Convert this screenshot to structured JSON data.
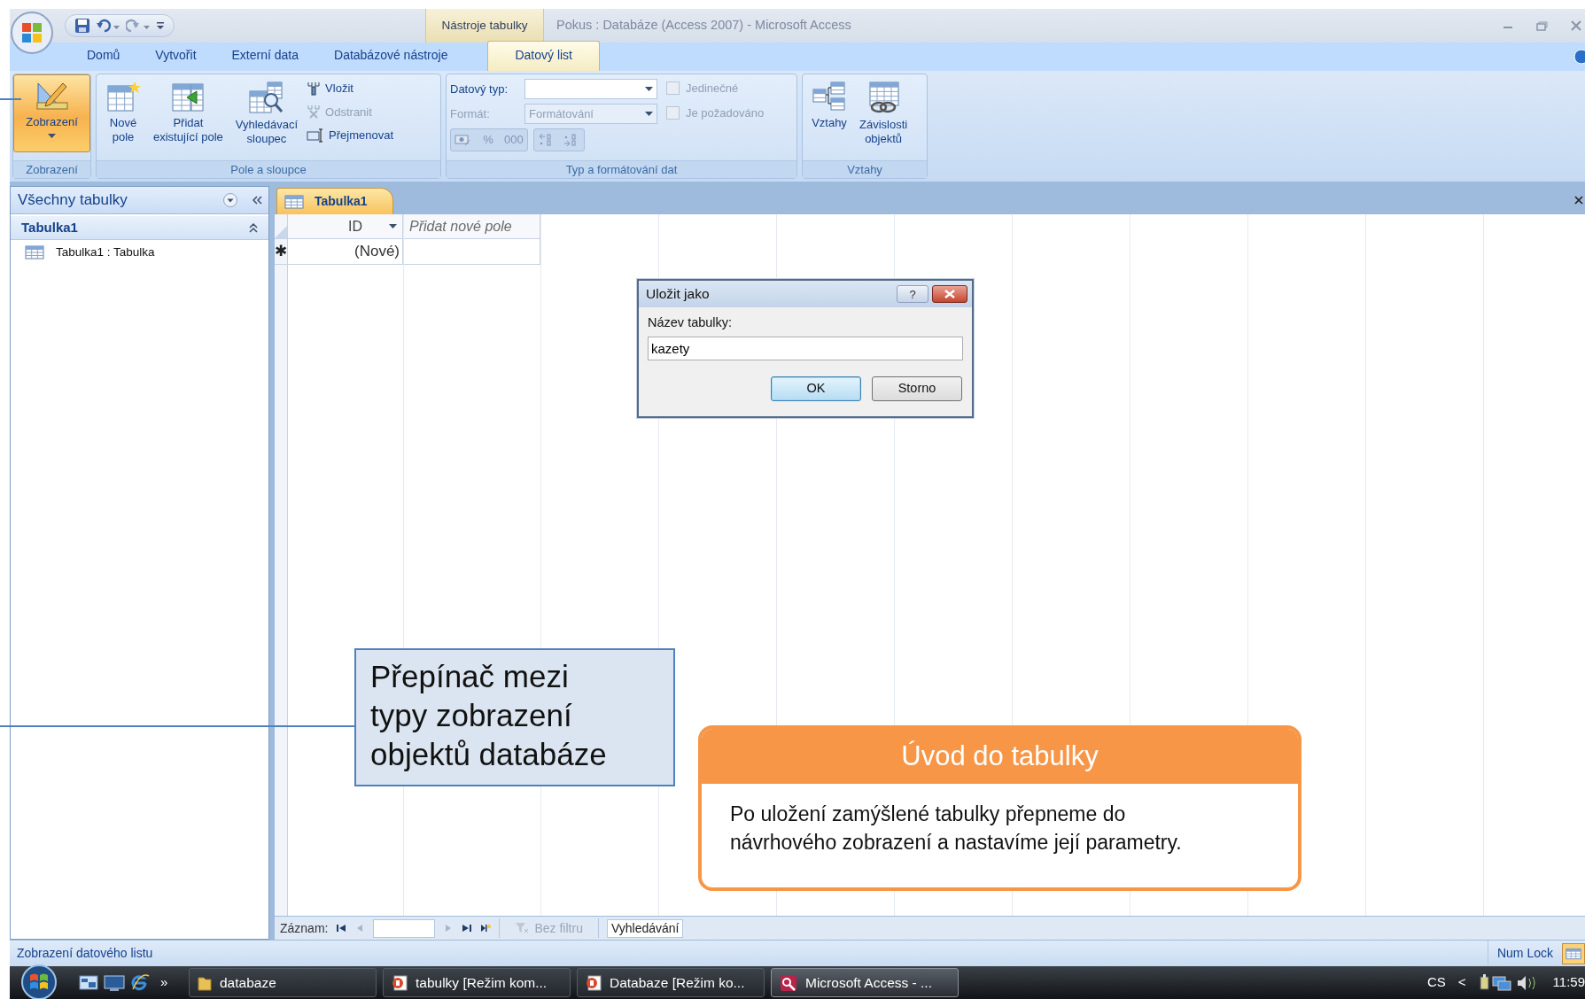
{
  "window": {
    "context_tab": "Nástroje tabulky",
    "title": "Pokus : Databáze (Access 2007) - Microsoft Access"
  },
  "ribbon_tabs": [
    {
      "label": "Domů",
      "selected": false
    },
    {
      "label": "Vytvořit",
      "selected": false
    },
    {
      "label": "Externí data",
      "selected": false
    },
    {
      "label": "Databázové nástroje",
      "selected": false
    },
    {
      "label": "Datový list",
      "selected": true
    }
  ],
  "ribbon_groups": [
    {
      "label": "Zobrazení",
      "items": [
        {
          "kind": "large",
          "lines": [
            "Zobrazení"
          ],
          "dropdown": true,
          "selected": true
        }
      ]
    },
    {
      "label": "Pole a sloupce",
      "items": [
        {
          "kind": "large",
          "lines": [
            "Nové",
            "pole"
          ],
          "dropdown": false,
          "selected": false
        },
        {
          "kind": "large",
          "lines": [
            "Přidat",
            "existující pole"
          ],
          "dropdown": false,
          "selected": false
        },
        {
          "kind": "large",
          "lines": [
            "Vyhledávací",
            "sloupec"
          ],
          "dropdown": false,
          "selected": false
        },
        {
          "kind": "stack",
          "items": [
            {
              "label": "Vložit",
              "disabled": false
            },
            {
              "label": "Odstranit",
              "disabled": true
            },
            {
              "label": "Přejmenovat",
              "disabled": false
            }
          ]
        }
      ]
    },
    {
      "label": "Typ a formátování dat",
      "items": [
        {
          "kind": "form",
          "rows": [
            {
              "label": "Datový typ:",
              "disabled": false
            },
            {
              "label": "Formát:",
              "value": "Formátování",
              "disabled": true
            }
          ],
          "buttons": [
            {
              "kind": "currency"
            },
            {
              "kind": "text",
              "label": "%"
            },
            {
              "kind": "text",
              "label": "000"
            },
            {
              "kind": "increase"
            },
            {
              "kind": "decrease"
            }
          ],
          "buttons_disabled": true
        },
        {
          "kind": "checks",
          "items": [
            {
              "label": "Jedinečné",
              "checked": false,
              "disabled": true
            },
            {
              "label": "Je požadováno",
              "checked": false,
              "disabled": true
            }
          ]
        }
      ]
    },
    {
      "label": "Vztahy",
      "items": [
        {
          "kind": "large",
          "lines": [
            "Vztahy"
          ],
          "dropdown": false,
          "selected": false
        },
        {
          "kind": "large",
          "lines": [
            "Závislosti",
            "objektů"
          ],
          "dropdown": false,
          "selected": false
        }
      ]
    }
  ],
  "nav_pane": {
    "title": "Všechny tabulky",
    "groups": [
      {
        "label": "Tabulka1",
        "expanded": true,
        "items": [
          {
            "label": "Tabulka1 : Tabulka"
          }
        ]
      }
    ]
  },
  "document_tabs": [
    {
      "label": "Tabulka1",
      "selected": true
    }
  ],
  "datasheet": {
    "columns": [
      {
        "label": "ID",
        "kind": "field"
      },
      {
        "label": "Přidat nové pole",
        "kind": "add"
      }
    ],
    "rows": [
      {
        "marker": "✱",
        "cells": [
          "(Nové)"
        ]
      }
    ]
  },
  "dialog": {
    "title": "Uložit jako",
    "help": "?",
    "label": "Název tabulky:",
    "value": "kazety",
    "buttons": [
      {
        "label": "OK",
        "default": true
      },
      {
        "label": "Storno",
        "default": false
      }
    ]
  },
  "record_nav": {
    "label": "Záznam:",
    "filter": "Bez filtru",
    "search": "Vyhledávání"
  },
  "status_bar": {
    "text": "Zobrazení datového listu",
    "indicator": "Num Lock"
  },
  "taskbar": {
    "overflow": "»",
    "items": [
      {
        "label": "databaze",
        "kind": "folder",
        "selected": false
      },
      {
        "label": "tabulky [Režim kom...",
        "kind": "slides",
        "selected": false
      },
      {
        "label": "Databaze [Režim ko...",
        "kind": "slides",
        "selected": false
      },
      {
        "label": "Microsoft Access - ...",
        "kind": "database",
        "selected": true
      }
    ],
    "language": "CS",
    "tray_toggle": "<",
    "clock": "11:59"
  },
  "callouts": {
    "note_lines": [
      "Přepínač mezi",
      "typy zobrazení",
      "objektů databáze"
    ],
    "info_title": "Úvod do tabulky",
    "info_lines": [
      "Po uložení zamýšlené tabulky přepneme do",
      "návrhového zobrazení a nastavíme její parametry."
    ]
  }
}
